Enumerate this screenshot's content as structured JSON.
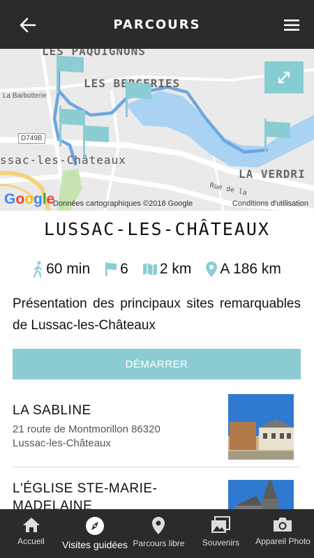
{
  "header": {
    "title": "PARCOURS",
    "back_icon": "arrow-left-icon",
    "menu_icon": "hamburger-menu-icon"
  },
  "map": {
    "labels": {
      "paquignons": "LES PAQUIGNONS",
      "bergeries": "LES BERGERIES",
      "barbotterie": "La Barbotterie",
      "lussac": "ssac-les-Châteaux",
      "verdri": "LA VERDRI",
      "rue": "Rue de la",
      "road": "D749B"
    },
    "google_logo": "Google",
    "attribution": "Données cartographiques ©2018 Google",
    "terms": "Conditions d'utilisation",
    "route_color": "#6ea6e0",
    "flag_color": "#8ccdd4",
    "expand_icon": "expand-icon"
  },
  "place": {
    "title": "LUSSAC-LES-CHÂTEAUX",
    "duration": "60 min",
    "stops": "6",
    "distance": "2 km",
    "away": "A 186 km",
    "description": "Présentation des principaux sites remarquables de Lussac-les-Châteaux"
  },
  "start_button": "DÉMARRER",
  "points": [
    {
      "name": "LA SABLINE",
      "address_line1": "21 route de Montmorillon 86320",
      "address_line2": "Lussac-les-Châteaux"
    },
    {
      "name": "L'ÉGLISE STE-MARIE-MADELAINE"
    }
  ],
  "nav": [
    {
      "label": "Accueil",
      "icon": "home-icon"
    },
    {
      "label": "Visites guidées",
      "icon": "compass-icon"
    },
    {
      "label": "Parcours libre",
      "icon": "map-pin-icon"
    },
    {
      "label": "Souvenirs",
      "icon": "photos-icon"
    },
    {
      "label": "Appareil Photo",
      "icon": "camera-icon"
    }
  ],
  "colors": {
    "bar": "#2b2b2b",
    "accent": "#8ccdd4"
  }
}
